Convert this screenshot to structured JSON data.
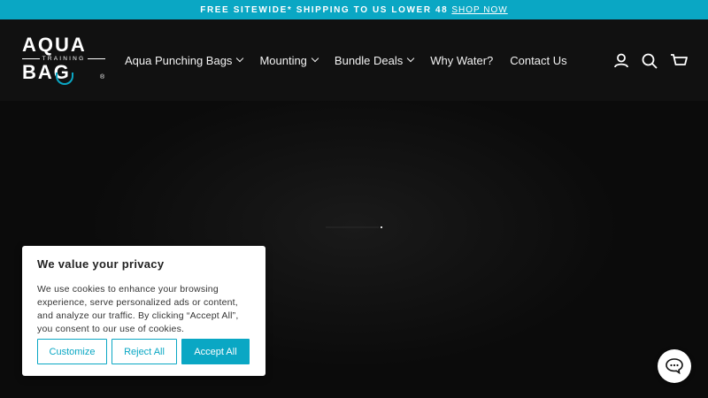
{
  "announcement": {
    "text": "FREE SITEWIDE* SHIPPING TO US LOWER 48",
    "link": "SHOP NOW"
  },
  "logo": {
    "line1": "AQUA",
    "line2": "TRAINING",
    "line3": "BAG",
    "mark": "®"
  },
  "nav": {
    "items": [
      {
        "label": "Aqua Punching Bags",
        "has_dropdown": true
      },
      {
        "label": "Mounting",
        "has_dropdown": true
      },
      {
        "label": "Bundle Deals",
        "has_dropdown": true
      },
      {
        "label": "Why Water?",
        "has_dropdown": false
      },
      {
        "label": "Contact Us",
        "has_dropdown": false
      }
    ]
  },
  "header_icons": [
    "account-icon",
    "search-icon",
    "cart-icon"
  ],
  "cookie_banner": {
    "title": "We value your privacy",
    "body": "We use cookies to enhance your browsing experience, serve personalized ads or content, and analyze our traffic. By clicking “Accept All”, you consent to our use of cookies.",
    "customize_label": "Customize",
    "reject_label": "Reject All",
    "accept_label": "Accept All"
  },
  "colors": {
    "accent": "#0aa7c4",
    "header_bg": "#111111",
    "page_bg": "#0b0b0b"
  },
  "chat_widget": {
    "icon": "chat-bubble-icon"
  }
}
